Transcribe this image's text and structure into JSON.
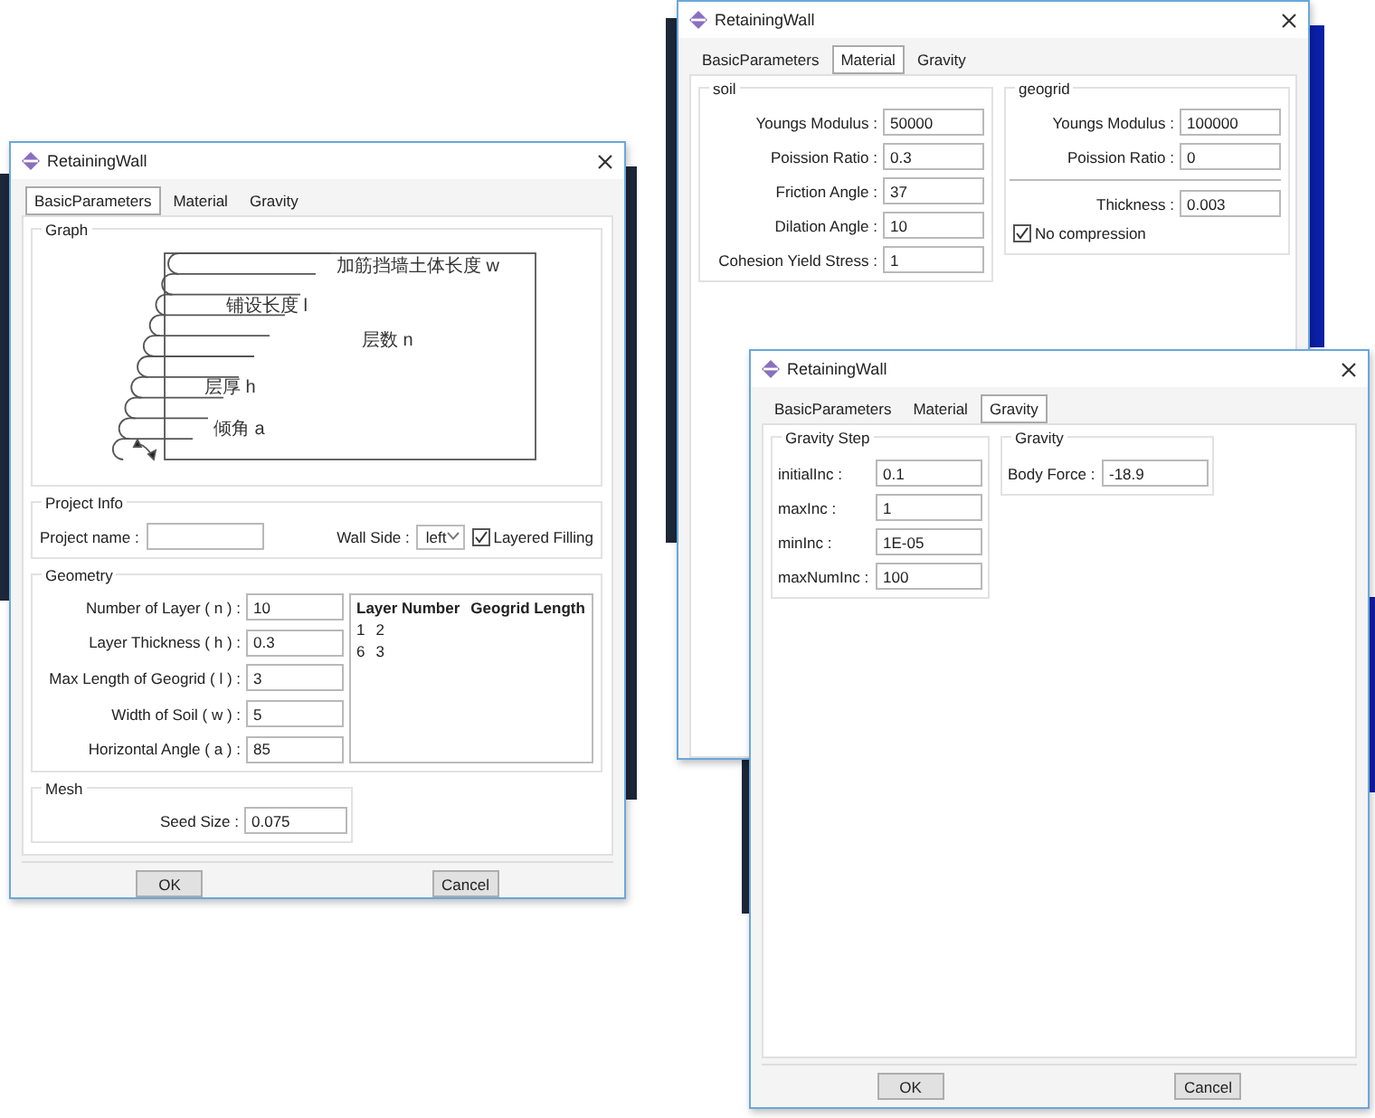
{
  "windows": [
    {
      "kind": "basic",
      "title": "RetainingWall",
      "tabs": [
        {
          "label": "BasicParameters",
          "selected": true
        },
        {
          "label": "Material",
          "selected": false
        },
        {
          "label": "Gravity",
          "selected": false
        }
      ],
      "graph": {
        "title": "Graph",
        "labels": [
          "加筋挡墙土体长度 w",
          "铺设长度 l",
          "层数 n",
          "层厚 h",
          "倾角 a"
        ]
      },
      "project_info": {
        "title": "Project Info",
        "project_name": {
          "label": "Project name :"
        },
        "wall_side": {
          "label": "Wall Side :",
          "value": "left"
        },
        "layered_filling": {
          "label": "Layered Filling",
          "checked": true
        }
      },
      "geometry": {
        "title": "Geometry",
        "fields": [
          {
            "label": "Number of Layer ( n ) :",
            "value": "10"
          },
          {
            "label": "Layer Thickness ( h ) :",
            "value": "0.3"
          },
          {
            "label": "Max Length of Geogrid ( l ) :",
            "value": "3"
          },
          {
            "label": "Width of Soil ( w ) :",
            "value": "5"
          },
          {
            "label": "Horizontal Angle ( a ) :",
            "value": "85"
          }
        ],
        "table": {
          "columns": [
            "Layer Number",
            "Geogrid Length"
          ],
          "rows": [
            [
              "1",
              "2"
            ],
            [
              "6",
              "3"
            ]
          ]
        }
      },
      "mesh": {
        "title": "Mesh",
        "fields": [
          {
            "label": "Seed Size :",
            "value": "0.075"
          }
        ]
      },
      "buttons": [
        "OK",
        "Cancel"
      ]
    },
    {
      "kind": "material",
      "title": "RetainingWall",
      "tabs": [
        {
          "label": "BasicParameters",
          "selected": false
        },
        {
          "label": "Material",
          "selected": true
        },
        {
          "label": "Gravity",
          "selected": false
        }
      ],
      "soil": {
        "title": "soil",
        "fields": [
          {
            "label": "Youngs Modulus :",
            "value": "50000"
          },
          {
            "label": "Poission Ratio :",
            "value": "0.3"
          },
          {
            "label": "Friction Angle :",
            "value": "37"
          },
          {
            "label": "Dilation Angle :",
            "value": "10"
          },
          {
            "label": "Cohesion Yield Stress :",
            "value": "1"
          }
        ]
      },
      "geogrid": {
        "title": "geogrid",
        "fields": [
          {
            "label": "Youngs Modulus :",
            "value": "100000"
          },
          {
            "label": "Poission Ratio :",
            "value": "0"
          }
        ],
        "thickness": {
          "label": "Thickness :",
          "value": "0.003"
        },
        "no_compression": {
          "label": "No compression",
          "checked": true
        }
      }
    },
    {
      "kind": "gravity",
      "title": "RetainingWall",
      "tabs": [
        {
          "label": "BasicParameters",
          "selected": false
        },
        {
          "label": "Material",
          "selected": false
        },
        {
          "label": "Gravity",
          "selected": true
        }
      ],
      "gravity_step": {
        "title": "Gravity Step",
        "fields": [
          {
            "label": "initialInc :",
            "value": "0.1"
          },
          {
            "label": "maxInc :",
            "value": "1"
          },
          {
            "label": "minInc :",
            "value": "1E-05"
          },
          {
            "label": "maxNumInc :",
            "value": "100"
          }
        ]
      },
      "gravity": {
        "title": "Gravity",
        "fields": [
          {
            "label": "Body Force :",
            "value": "-18.9"
          }
        ]
      },
      "buttons": [
        "OK",
        "Cancel"
      ]
    }
  ]
}
